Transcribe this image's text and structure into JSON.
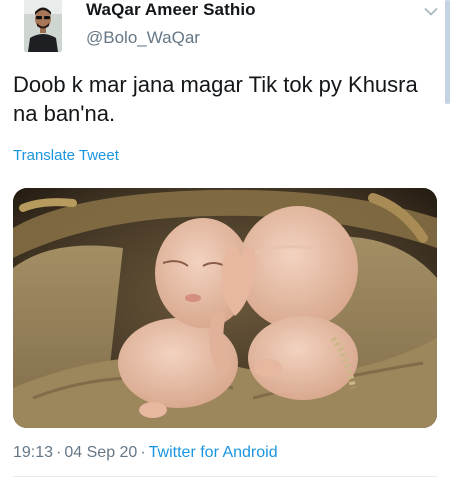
{
  "tweet": {
    "author_name": "WaQar Ameer Sathio",
    "author_handle": "@Bolo_WaQar",
    "text": "Doob k mar jana magar Tik tok py Khusra na ban'na.",
    "translate_label": "Translate Tweet",
    "time": "19:13",
    "date": "04 Sep 20",
    "separator": "·",
    "source": "Twitter for Android"
  },
  "icons": {
    "menu_caret": "chevron-down-icon",
    "avatar": "avatar"
  },
  "colors": {
    "link": "#1b95e0",
    "secondary_text": "#657786",
    "primary_text": "#14171a",
    "divider": "#e6ecf0"
  }
}
